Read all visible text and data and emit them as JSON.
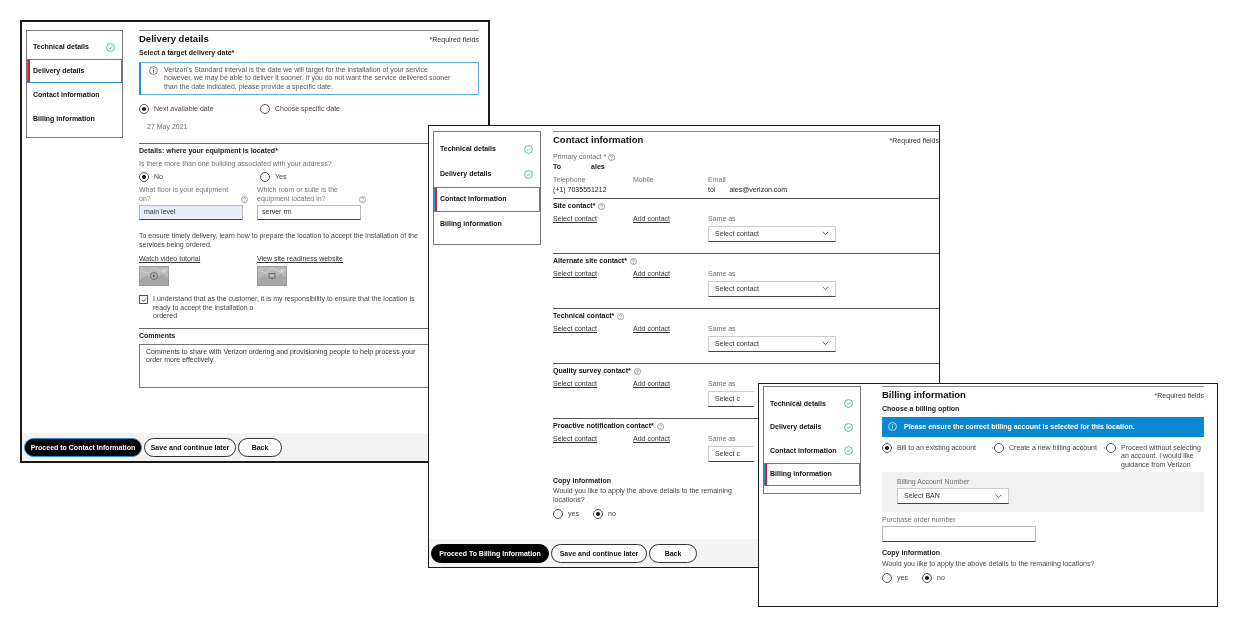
{
  "windows": [
    {
      "kind": "delivery",
      "sidebar": [
        {
          "label": "Technical details",
          "completed": true,
          "selected": false
        },
        {
          "label": "Delivery details",
          "completed": false,
          "selected": true
        },
        {
          "label": "Contact information",
          "completed": false,
          "selected": false
        },
        {
          "label": "Billing information",
          "completed": false,
          "selected": false
        }
      ],
      "title": "Delivery details",
      "required_note": "*Required fields",
      "date_prompt": "Select a target delivery date*",
      "info_text": "Verizon's Standard interval is the date we will target for the installation of your service however, we may be able to deliver it sooner. If you do not want the service delivered sooner than the date indicated, please provide a specific date.",
      "date_options": [
        {
          "label": "Next available date",
          "selected": true
        },
        {
          "label": "Choose specific date",
          "selected": false
        }
      ],
      "date_value": "27 May 2021",
      "location_heading": "Details: where your equipment is located*",
      "building_question": "Is there more than one building associated with your address?",
      "building_options": [
        {
          "label": "No",
          "selected": true
        },
        {
          "label": "Yes",
          "selected": false
        }
      ],
      "fields": [
        {
          "label": "What floor is your equipment on?",
          "value": "main level",
          "focused": true
        },
        {
          "label": "Which room or suite is the equipment located in?",
          "value": "server rm",
          "focused": false
        }
      ],
      "prep_text": "To ensure timely delivery, learn how to prepare the location to accept the installation of the services being ordered.",
      "resources": [
        {
          "label": "Watch video tutorial",
          "kind": "video"
        },
        {
          "label": "View site readiness website",
          "kind": "website"
        }
      ],
      "agreement": {
        "text": "I understand that as the customer, it is my responsibility to ensure that the location is ready to accept the installation o\nordered",
        "checked": true
      },
      "comments": {
        "label": "Comments",
        "value": "Comments to share with Verizon ordering and provisioning people to help process your order more effectively"
      },
      "buttons": [
        {
          "label": "Proceed to Contact Information",
          "kind": "primary",
          "highlighted": true
        },
        {
          "label": "Save and continue later",
          "kind": "secondary",
          "highlighted": false
        },
        {
          "label": "Back",
          "kind": "secondary",
          "highlighted": false
        }
      ]
    },
    {
      "kind": "contact",
      "sidebar": [
        {
          "label": "Technical details",
          "completed": true,
          "selected": false
        },
        {
          "label": "Delivery details",
          "completed": true,
          "selected": false
        },
        {
          "label": "Contact information",
          "completed": false,
          "selected": true
        },
        {
          "label": "Billing information",
          "completed": false,
          "selected": false
        }
      ],
      "title": "Contact information",
      "required_note": "*Required fields",
      "primary_contact": {
        "label": "Primary contact *",
        "name_start": "To",
        "name_end": "ales"
      },
      "details": [
        {
          "label": "Telephone",
          "value": "(+1) 7035551212"
        },
        {
          "label": "Mobile"
        },
        {
          "label": "Email",
          "value_start": "toi",
          "value_end": "ales@verizon.com"
        }
      ],
      "sections": [
        {
          "title": "Site contact*",
          "select_link": "Select contact",
          "add_link": "Add contact",
          "same_as": "Same as",
          "dropdown": {
            "value": "Select contact",
            "chevron": true
          }
        },
        {
          "title": "Alternate site contact*",
          "select_link": "Select contact",
          "add_link": "Add contact",
          "same_as": "Same as",
          "dropdown": {
            "value": "Select contact",
            "chevron": true
          }
        },
        {
          "title": "Technical contact*",
          "select_link": "Select contact",
          "add_link": "Add contact",
          "same_as": "Same as",
          "dropdown": {
            "value": "Select contact",
            "chevron": true
          }
        },
        {
          "title": "Quality survey contact*",
          "select_link": "Select contact",
          "add_link": "Add contact",
          "same_as": "Same as",
          "dropdown": {
            "value": "Select c",
            "chevron": false
          }
        },
        {
          "title": "Proactive notification contact*",
          "select_link": "Select contact",
          "add_link": "Add contact",
          "same_as": "Same as",
          "dropdown": {
            "value": "Select c",
            "chevron": false
          }
        }
      ],
      "copy": {
        "title": "Copy information",
        "question": "Would you like to apply the above details to the remaining locations?",
        "options": [
          {
            "label": "yes",
            "selected": false
          },
          {
            "label": "no",
            "selected": true
          }
        ]
      },
      "buttons": [
        {
          "label": "Proceed To Billing Information",
          "kind": "primary",
          "highlighted": false
        },
        {
          "label": "Save and continue later",
          "kind": "secondary",
          "highlighted": false
        },
        {
          "label": "Back",
          "kind": "secondary",
          "highlighted": false
        }
      ]
    },
    {
      "kind": "billing",
      "sidebar": [
        {
          "label": "Technical details",
          "completed": true,
          "selected": false
        },
        {
          "label": "Delivery details",
          "completed": true,
          "selected": false
        },
        {
          "label": "Contact information",
          "completed": true,
          "selected": false
        },
        {
          "label": "Billing information",
          "completed": false,
          "selected": true
        }
      ],
      "title": "Billing information",
      "required_note": "*Required fields",
      "option_prompt": "Choose a billing option",
      "banner": "Please ensure the correct billing account is selected for this location.",
      "billing_options": [
        {
          "label": "Bill to an existing account",
          "selected": true
        },
        {
          "label": "Create a new billing account",
          "selected": false
        },
        {
          "label": "Proceed without selecting an account. I would like guidance from Verizon",
          "selected": false
        }
      ],
      "account": {
        "label": "Billing Account Number",
        "value": "Select BAN"
      },
      "purchase_order": {
        "label": "Purchase order number"
      },
      "copy": {
        "title": "Copy information",
        "question": "Would you like to apply the above details to the remaining locations?",
        "options": [
          {
            "label": "yes",
            "selected": false
          },
          {
            "label": "no",
            "selected": true
          }
        ]
      }
    }
  ]
}
